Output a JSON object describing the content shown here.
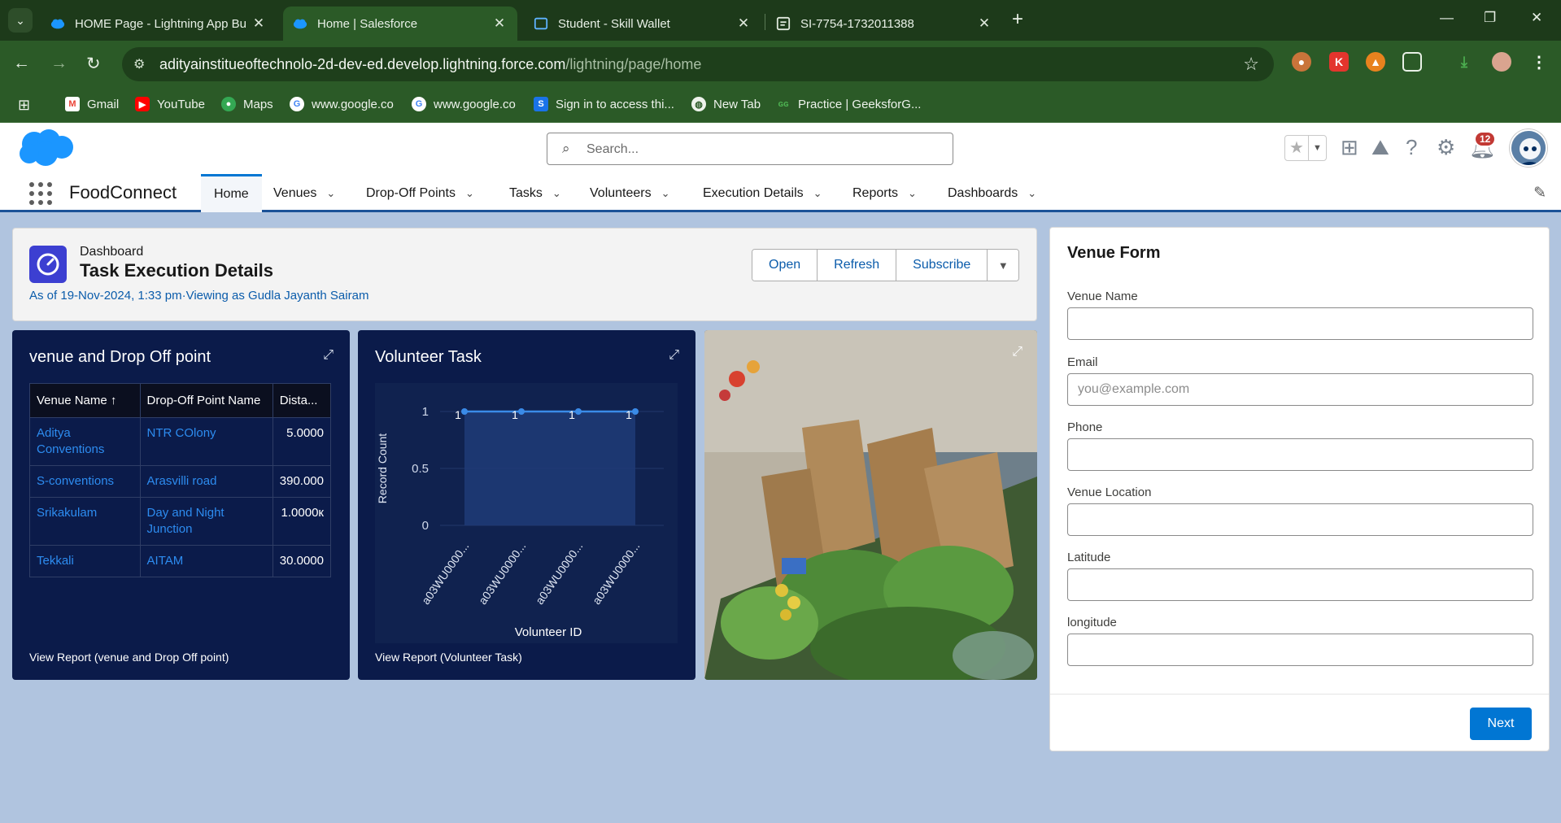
{
  "browser": {
    "tabs": [
      {
        "title": "HOME Page - Lightning App Bu",
        "active": false
      },
      {
        "title": "Home | Salesforce",
        "active": true
      },
      {
        "title": "Student - Skill Wallet",
        "active": false
      },
      {
        "title": "SI-7754-1732011388",
        "active": false
      }
    ],
    "url_host": "adityainstitueoftechnolo-2d-dev-ed.develop.lightning.force.com",
    "url_path": "/lightning/page/home",
    "bookmarks": [
      {
        "label": "Gmail"
      },
      {
        "label": "YouTube"
      },
      {
        "label": "Maps"
      },
      {
        "label": "www.google.co"
      },
      {
        "label": "www.google.co"
      },
      {
        "label": "Sign in to access thi..."
      },
      {
        "label": "New Tab"
      },
      {
        "label": "Practice | GeeksforG..."
      }
    ]
  },
  "sf": {
    "search_placeholder": "Search...",
    "notification_count": "12",
    "app_name": "FoodConnect",
    "nav_tabs": [
      {
        "label": "Home",
        "active": true
      },
      {
        "label": "Venues"
      },
      {
        "label": "Drop-Off Points"
      },
      {
        "label": "Tasks"
      },
      {
        "label": "Volunteers"
      },
      {
        "label": "Execution Details"
      },
      {
        "label": "Reports"
      },
      {
        "label": "Dashboards"
      }
    ]
  },
  "dashboard": {
    "label": "Dashboard",
    "title": "Task Execution Details",
    "as_of": "As of 19-Nov-2024, 1:33 pm·Viewing as Gudla Jayanth Sairam",
    "buttons": {
      "open": "Open",
      "refresh": "Refresh",
      "subscribe": "Subscribe"
    }
  },
  "venue_widget": {
    "title": "venue and Drop Off point",
    "columns": [
      "Venue Name ↑",
      "Drop-Off Point Name",
      "Dista..."
    ],
    "rows": [
      [
        "Aditya Conventions",
        "NTR COlony",
        "5.0000"
      ],
      [
        "S-conventions",
        "Arasvilli road",
        "390.000"
      ],
      [
        "Srikakulam",
        "Day and Night Junction",
        "1.0000к"
      ],
      [
        "Tekkali",
        "AITAM",
        "30.0000"
      ]
    ],
    "footer": "View Report (venue and Drop Off point)"
  },
  "volunteer_widget": {
    "title": "Volunteer Task",
    "footer": "View Report (Volunteer Task)"
  },
  "chart_data": {
    "type": "area",
    "title": "Volunteer Task",
    "xlabel": "Volunteer ID",
    "ylabel": "Record Count",
    "categories": [
      "a03WU0000...",
      "a03WU0000...",
      "a03WU0000...",
      "a03WU0000..."
    ],
    "values": [
      1,
      1,
      1,
      1
    ],
    "data_labels": [
      "1",
      "1",
      "1",
      "1"
    ],
    "y_ticks": [
      "0",
      "0.5",
      "1"
    ],
    "ylim": [
      0,
      1
    ],
    "grid": true,
    "color": "#3a8be8"
  },
  "venue_form": {
    "title": "Venue Form",
    "fields": [
      {
        "label": "Venue Name",
        "placeholder": "",
        "value": ""
      },
      {
        "label": "Email",
        "placeholder": "you@example.com",
        "value": ""
      },
      {
        "label": "Phone",
        "placeholder": "",
        "value": ""
      },
      {
        "label": "Venue Location",
        "placeholder": "",
        "value": ""
      },
      {
        "label": "Latitude",
        "placeholder": "",
        "value": ""
      },
      {
        "label": "longitude",
        "placeholder": "",
        "value": ""
      }
    ],
    "next_label": "Next"
  },
  "colors": {
    "chrome_dark": "#1d3a1a",
    "chrome": "#2b5a27",
    "sf_brand": "#0176d3",
    "widget_bg": "#0b1b4a",
    "link": "#2d8cf0"
  }
}
